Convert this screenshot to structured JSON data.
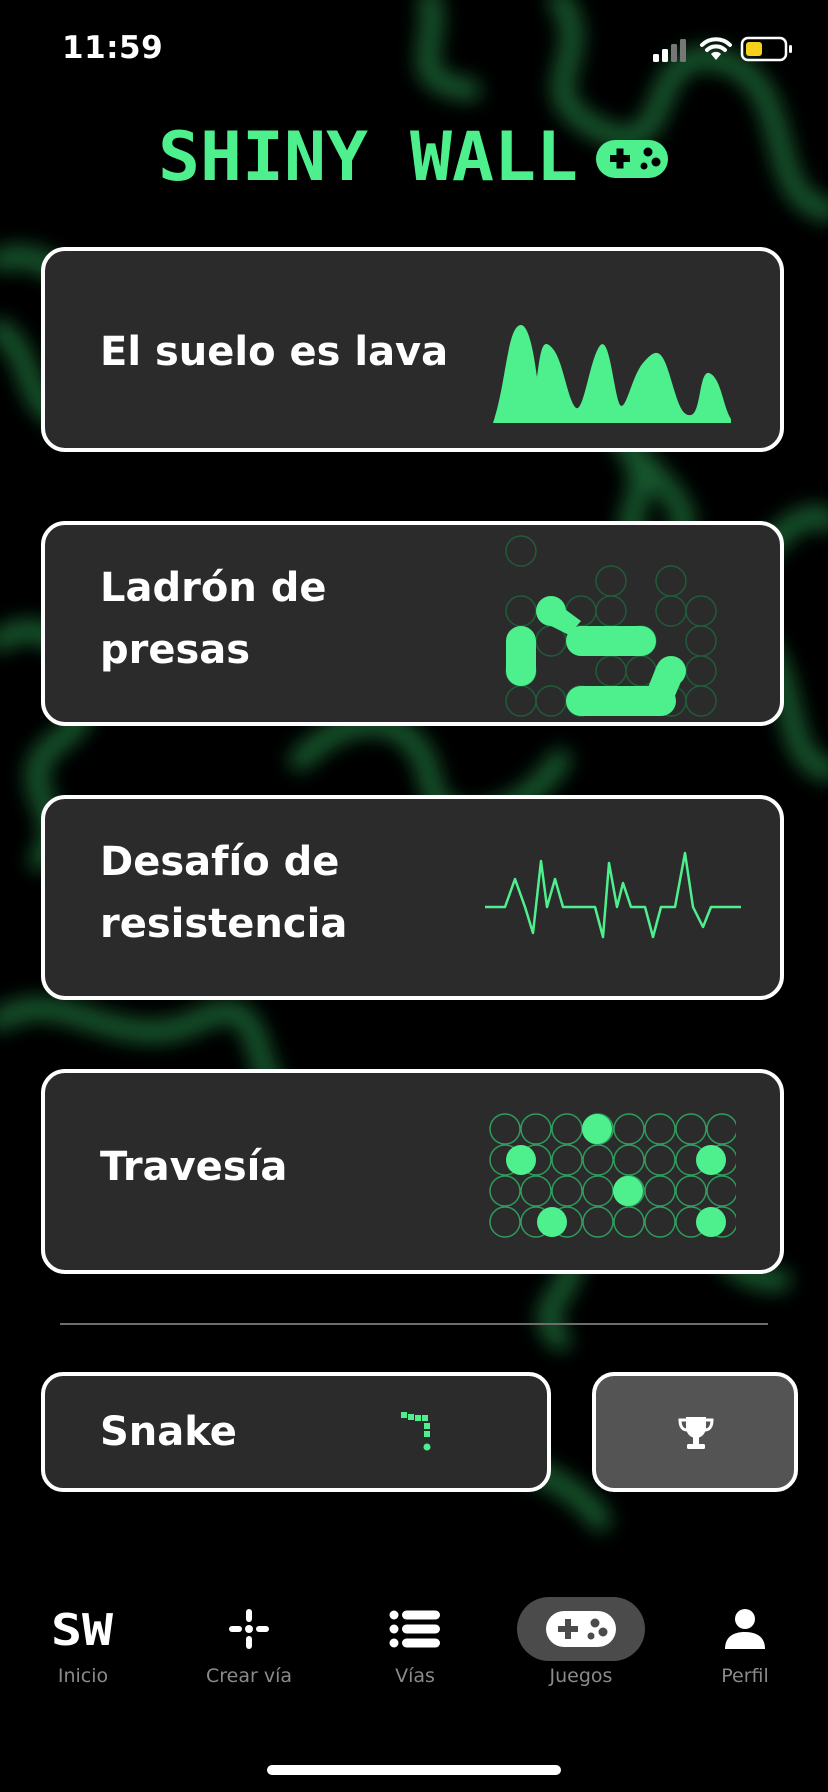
{
  "status_bar": {
    "time": "11:59"
  },
  "header": {
    "logo_text": "SHINY WALL"
  },
  "games": [
    {
      "title": "El suelo es lava",
      "icon": "lava-wave-icon"
    },
    {
      "title_line1": "Ladrón de",
      "title_line2": "presas",
      "icon": "hold-path-icon"
    },
    {
      "title_line1": "Desafío de",
      "title_line2": "resistencia",
      "icon": "heartbeat-icon"
    },
    {
      "title": "Travesía",
      "icon": "dot-grid-icon"
    }
  ],
  "snake": {
    "title": "Snake",
    "icon": "snake-icon",
    "ranking_icon": "trophy-icon"
  },
  "nav": {
    "items": [
      {
        "label": "Inicio",
        "icon": "sw-logo-icon"
      },
      {
        "label": "Crear vía",
        "icon": "sparkle-icon"
      },
      {
        "label": "Vías",
        "icon": "list-icon"
      },
      {
        "label": "Juegos",
        "icon": "gamepad-icon",
        "active": true
      },
      {
        "label": "Perfil",
        "icon": "user-icon"
      }
    ]
  },
  "colors": {
    "accent": "#4ef08e",
    "card_bg": "#2b2b2b",
    "background": "#000000"
  }
}
